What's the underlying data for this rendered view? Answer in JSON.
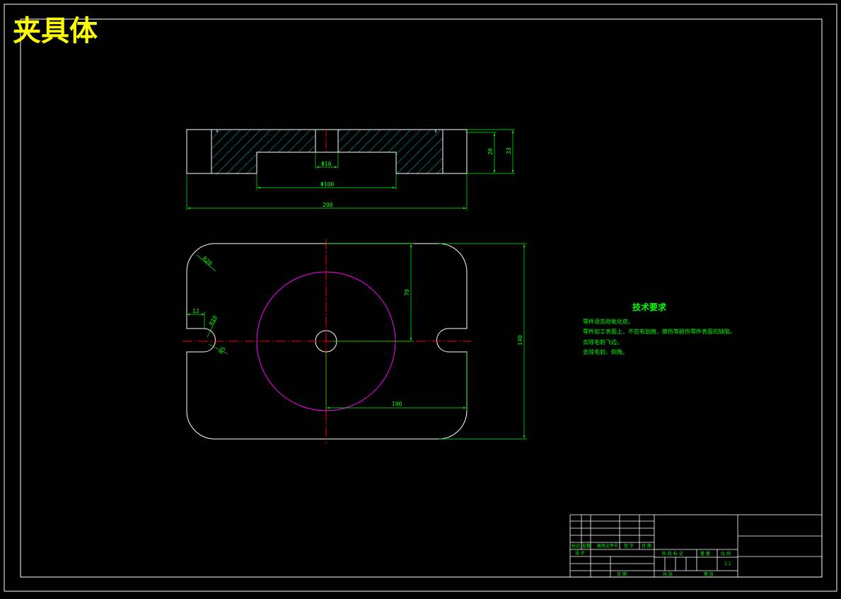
{
  "drawing": {
    "title": "夹具体",
    "colors": {
      "background": "#000000",
      "outline": "#ffffff",
      "dimension": "#00ff00",
      "hatch": "#00ffff",
      "centerline": "#ff0000",
      "circle": "#ff00ff",
      "title": "#ffff00"
    }
  },
  "section_view": {
    "dims": {
      "hole_width": "Φ10",
      "recess_width": "Φ100",
      "overall_width": "200",
      "recess_depth": "20",
      "total_height": "33"
    }
  },
  "plan_view": {
    "dims": {
      "corner_radius": "R20",
      "slot_width": "12",
      "slot_radius": "R10",
      "slot_inner_radius": "R5",
      "half_height": "70",
      "overall_height": "140",
      "half_width": "100"
    }
  },
  "tech_requirements": {
    "heading": "技术要求",
    "lines": [
      "零件须去除氧化皮。",
      "零件加工表面上，不应有划痕，擦伤等损伤零件表面的缺陷。",
      "去除毛刺飞边。",
      "去除毛刺，倒角。"
    ]
  },
  "title_block": {
    "labels": {
      "mark": "标记",
      "count": "处数",
      "change_doc": "更改文件号",
      "signature": "签 字",
      "date": "日 期",
      "design": "设 计",
      "stage_mark": "阶 段 标 记",
      "weight": "重 量",
      "scale": "比 例",
      "scale_value": "1:1",
      "approve": "日 期",
      "total": "共 张",
      "sheet": "第 张"
    }
  }
}
